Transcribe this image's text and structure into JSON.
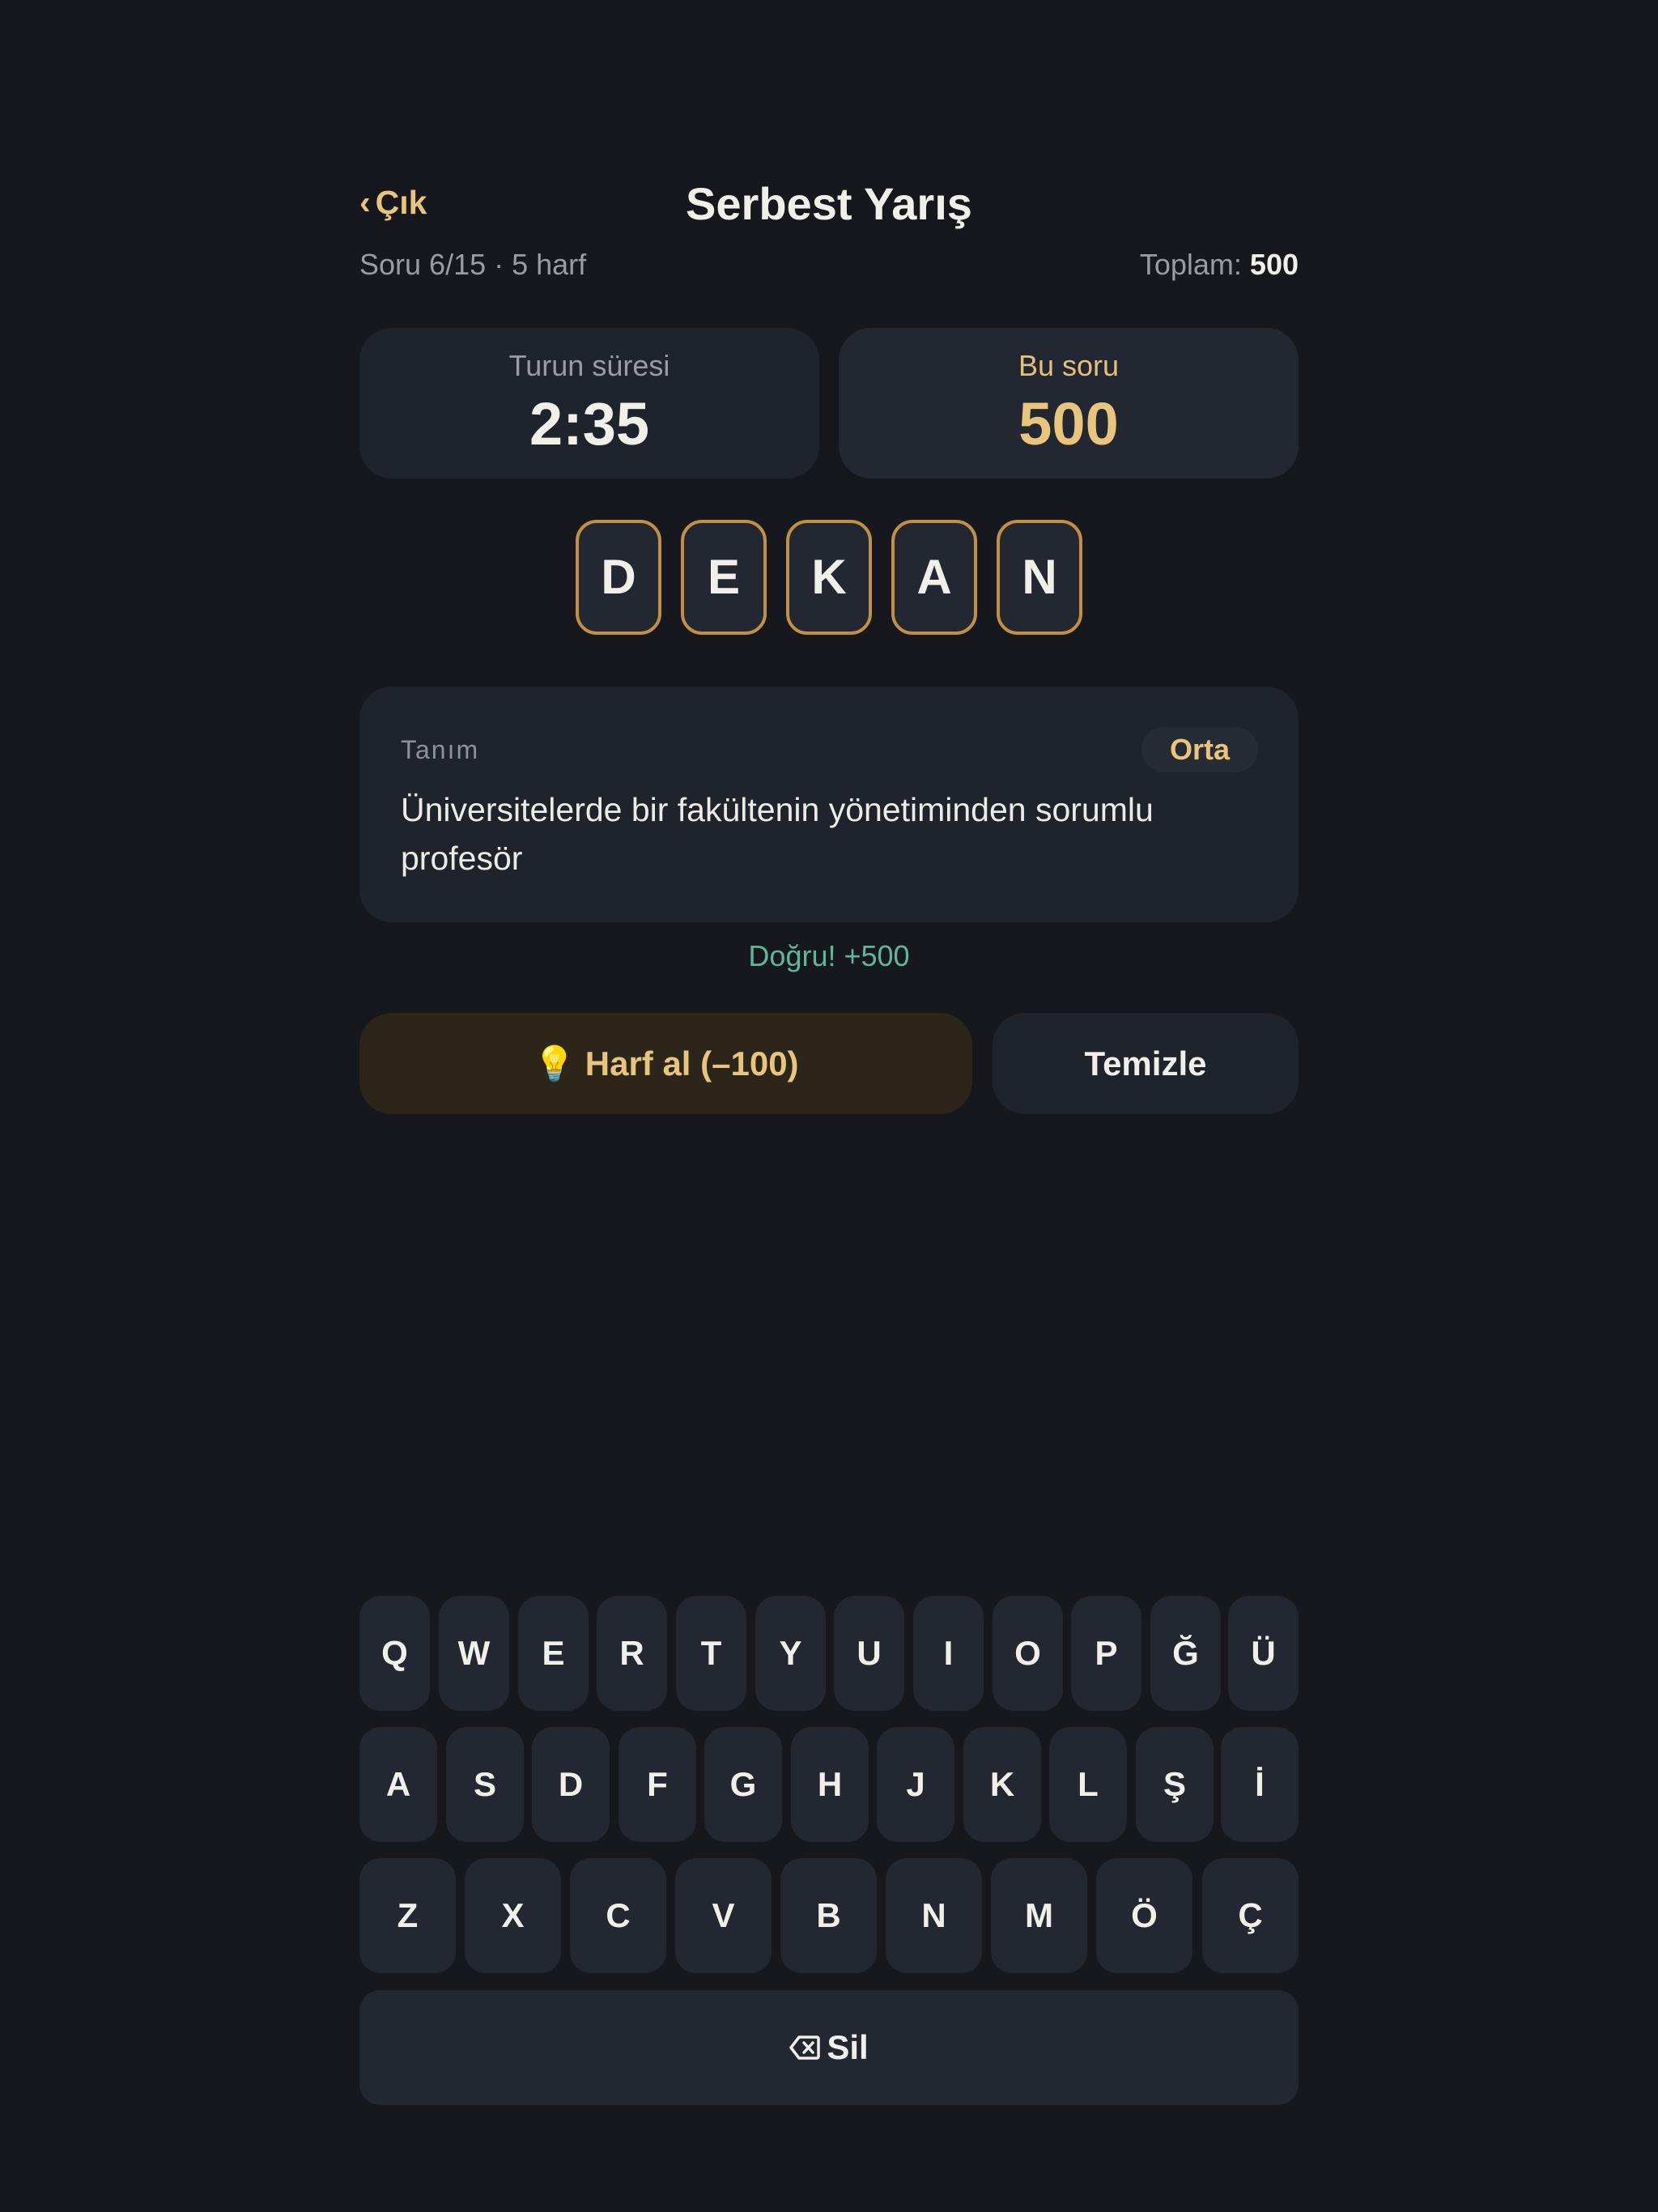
{
  "header": {
    "back_label": "Çık",
    "title": "Serbest Yarış"
  },
  "status": {
    "progress_text": "Soru 6/15 · 5 harf",
    "total_label": "Toplam:",
    "total_value": "500"
  },
  "stats": {
    "timer_label": "Turun süresi",
    "timer_value": "2:35",
    "score_label": "Bu soru",
    "score_value": "500"
  },
  "answer": {
    "letters": [
      "D",
      "E",
      "K",
      "A",
      "N"
    ]
  },
  "definition": {
    "label": "Tanım",
    "difficulty": "Orta",
    "text": "Üniversitelerde bir fakültenin yönetiminden sorumlu profesör"
  },
  "feedback": "Doğru! +500",
  "actions": {
    "hint_icon": "💡",
    "hint_label": "Harf al (–100)",
    "clear_label": "Temizle"
  },
  "keyboard": {
    "rows": [
      [
        "Q",
        "W",
        "E",
        "R",
        "T",
        "Y",
        "U",
        "I",
        "O",
        "P",
        "Ğ",
        "Ü"
      ],
      [
        "A",
        "S",
        "D",
        "F",
        "G",
        "H",
        "J",
        "K",
        "L",
        "Ş",
        "İ"
      ],
      [
        "Z",
        "X",
        "C",
        "V",
        "B",
        "N",
        "M",
        "Ö",
        "Ç"
      ]
    ],
    "delete_label": "Sil",
    "delete_icon": "backspace-icon"
  },
  "colors": {
    "background": "#17181d",
    "card": "#1f232b",
    "accent_gold": "#e9c47d",
    "tile_border": "#c28f45",
    "success": "#5fb79a"
  }
}
